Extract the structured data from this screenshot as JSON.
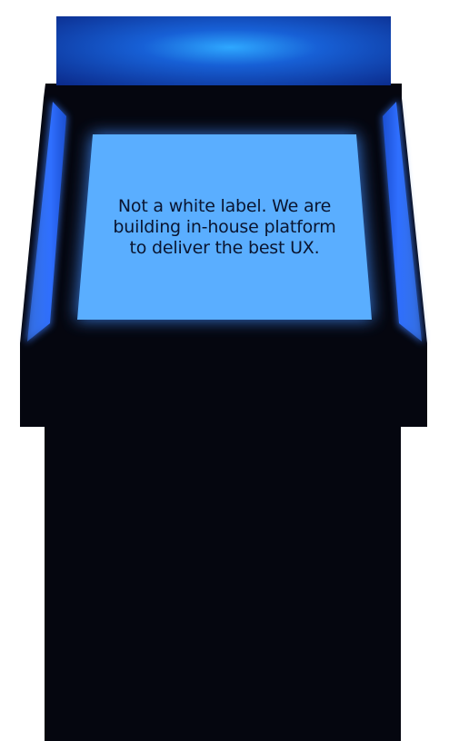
{
  "screen": {
    "message": "Not a white label. We are building in-house platform to deliver the best UX."
  },
  "colors": {
    "cabinet_body": "#05060f",
    "marquee_dark": "#0b2a8a",
    "marquee_glow": "#2ea8ff",
    "screen_fill": "#5aaeff",
    "side_glow": "#3a7dff",
    "text": "#0a1530"
  }
}
